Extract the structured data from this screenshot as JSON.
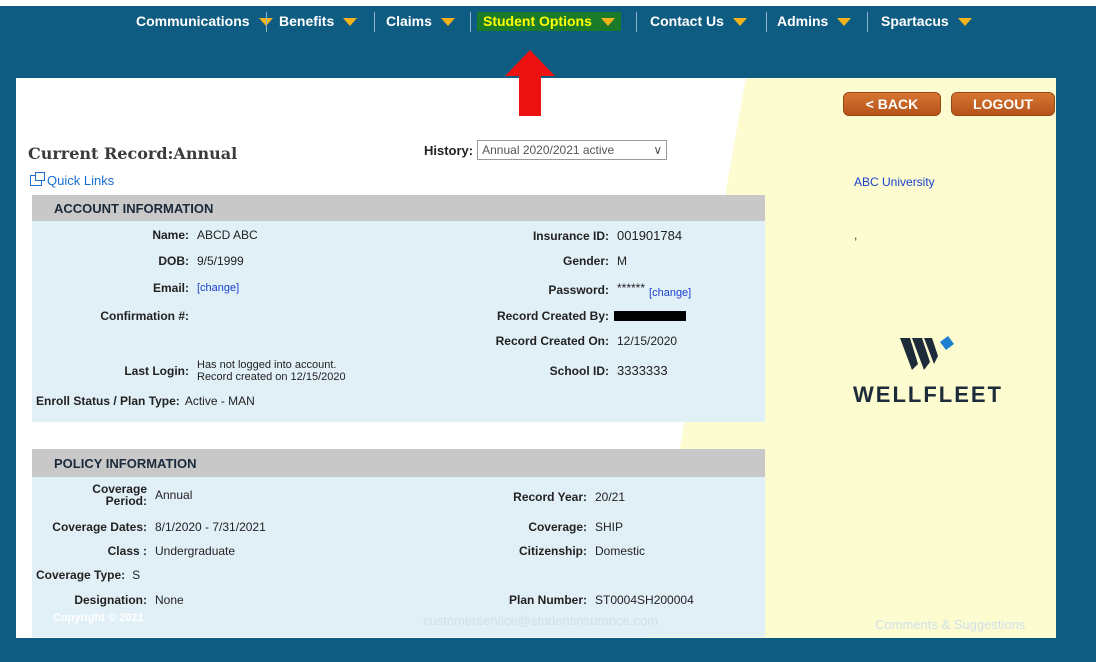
{
  "navbar": {
    "items": [
      {
        "label": "Communications"
      },
      {
        "label": "Benefits"
      },
      {
        "label": "Claims"
      },
      {
        "label": "Student Options",
        "active": true
      },
      {
        "label": "Contact Us"
      },
      {
        "label": "Admins"
      },
      {
        "label": "Spartacus"
      }
    ]
  },
  "buttons": {
    "back": "< BACK",
    "logout": "LOGOUT"
  },
  "header": {
    "title": "Current Record:Annual",
    "history_label": "History:",
    "history_value": "Annual 2020/2021 active",
    "quick_links": "Quick Links"
  },
  "right_panel": {
    "university": "ABC University",
    "dot": ",",
    "logo_text": "WELLFLEET"
  },
  "account": {
    "heading": "ACCOUNT INFORMATION",
    "name_label": "Name:",
    "name": "ABCD ABC",
    "dob_label": "DOB:",
    "dob": "9/5/1999",
    "email_label": "Email:",
    "email_change": "[change]",
    "confirmation_label": "Confirmation #:",
    "last_login_label": "Last Login:",
    "last_login_1": "Has not logged into account.",
    "last_login_2": "Record created on 12/15/2020",
    "enroll_label": "Enroll Status / Plan Type:",
    "enroll": "Active - MAN",
    "insurance_label": "Insurance ID:",
    "insurance": "001901784",
    "gender_label": "Gender:",
    "gender": "M",
    "password_label": "Password:",
    "password": "******",
    "password_change": "[change]",
    "created_by_label": "Record Created By:",
    "created_on_label": "Record Created On:",
    "created_on": "12/15/2020",
    "school_label": "School ID:",
    "school": "3333333"
  },
  "policy": {
    "heading": "POLICY INFORMATION",
    "period_label_1": "Coverage",
    "period_label_2": "Period:",
    "period": "Annual",
    "dates_label": "Coverage Dates:",
    "dates": "8/1/2020 - 7/31/2021",
    "class_label": "Class :",
    "class": "Undergraduate",
    "type_label": "Coverage Type:",
    "type": "S",
    "designation_label": "Designation:",
    "designation": "None",
    "year_label": "Record Year:",
    "year": "20/21",
    "coverage_label": "Coverage:",
    "coverage": "SHIP",
    "citizenship_label": "Citizenship:",
    "citizenship": "Domestic",
    "plan_label": "Plan Number:",
    "plan": "ST0004SH200004"
  },
  "footer": {
    "copyright": "Copyright © 2021",
    "email": "customerservice@studentinsurance.com",
    "comments": "Comments & Suggestions"
  },
  "colors": {
    "nav": "#0f5c82",
    "accent_yellow": "#f4b31a",
    "button": "#c4621f",
    "section_bg": "#e1f0f7"
  }
}
